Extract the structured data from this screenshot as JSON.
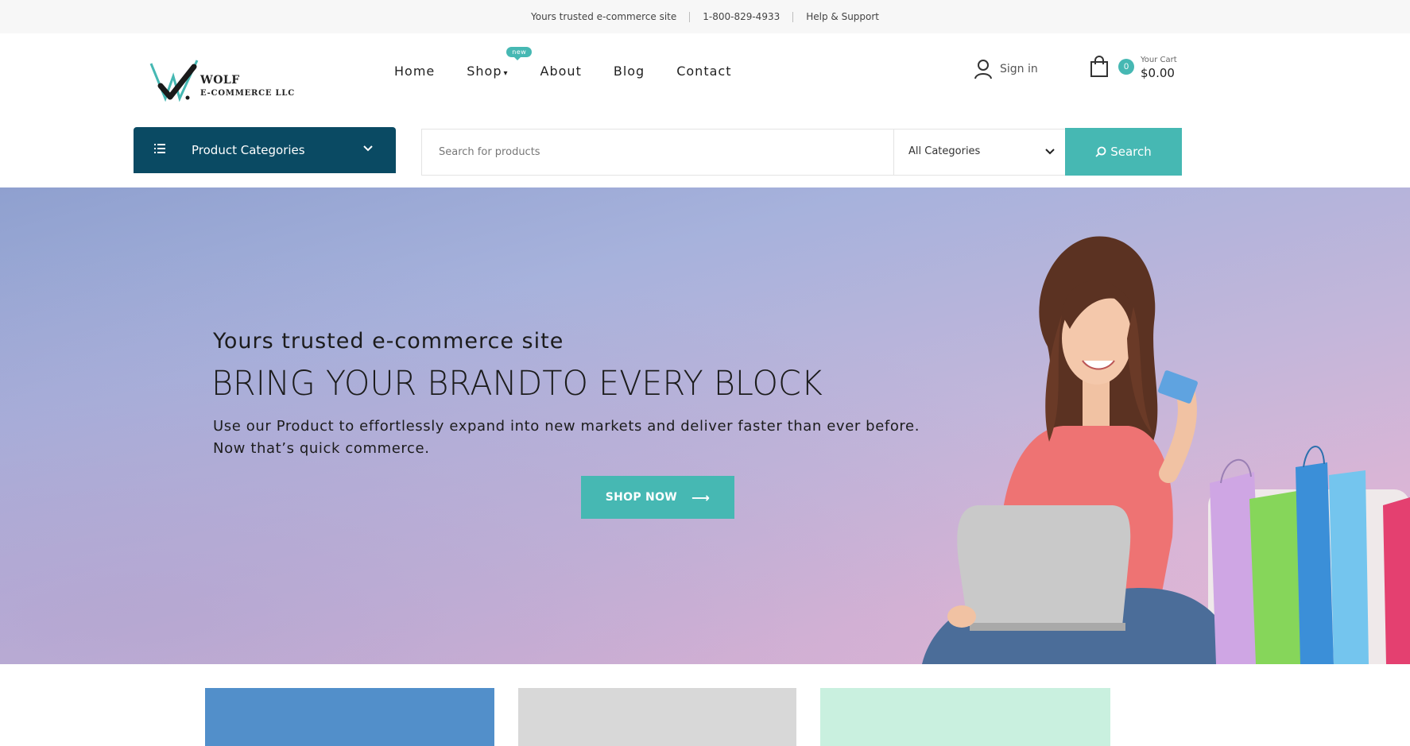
{
  "topbar": {
    "items": [
      "Yours trusted e-commerce site",
      "1-800-829-4933",
      "Help & Support"
    ]
  },
  "logo": {
    "line1": "WOLF",
    "line2": "E-COMMERCE LLC"
  },
  "nav": {
    "items": [
      {
        "label": "Home"
      },
      {
        "label": "Shop",
        "badge": "new"
      },
      {
        "label": "About"
      },
      {
        "label": "Blog"
      },
      {
        "label": "Contact"
      }
    ]
  },
  "account": {
    "signin_label": "Sign in"
  },
  "cart": {
    "count": "0",
    "label": "Your Cart",
    "total": "$0.00"
  },
  "categories_button": {
    "label": "Product Categories"
  },
  "search": {
    "placeholder": "Search for products",
    "category_selected": "All Categories",
    "button_label": "Search"
  },
  "hero": {
    "kicker": "Yours trusted e-commerce site",
    "title": "BRING YOUR BRANDTO EVERY BLOCK",
    "description_line1": "Use our Product to effortlessly expand into new markets and deliver faster than ever before.",
    "description_line2": "Now that’s quick commerce.",
    "cta_label": "SHOP NOW"
  },
  "colors": {
    "accent": "#46b8b3",
    "categories_bg": "#0a4a63",
    "card1": "#528fca",
    "card2": "#d8d8d8",
    "card3": "#c9f0df"
  },
  "icons": [
    "list-icon",
    "chevron-down-icon",
    "search-icon",
    "user-icon",
    "shopping-bag-icon",
    "arrow-right-icon"
  ]
}
